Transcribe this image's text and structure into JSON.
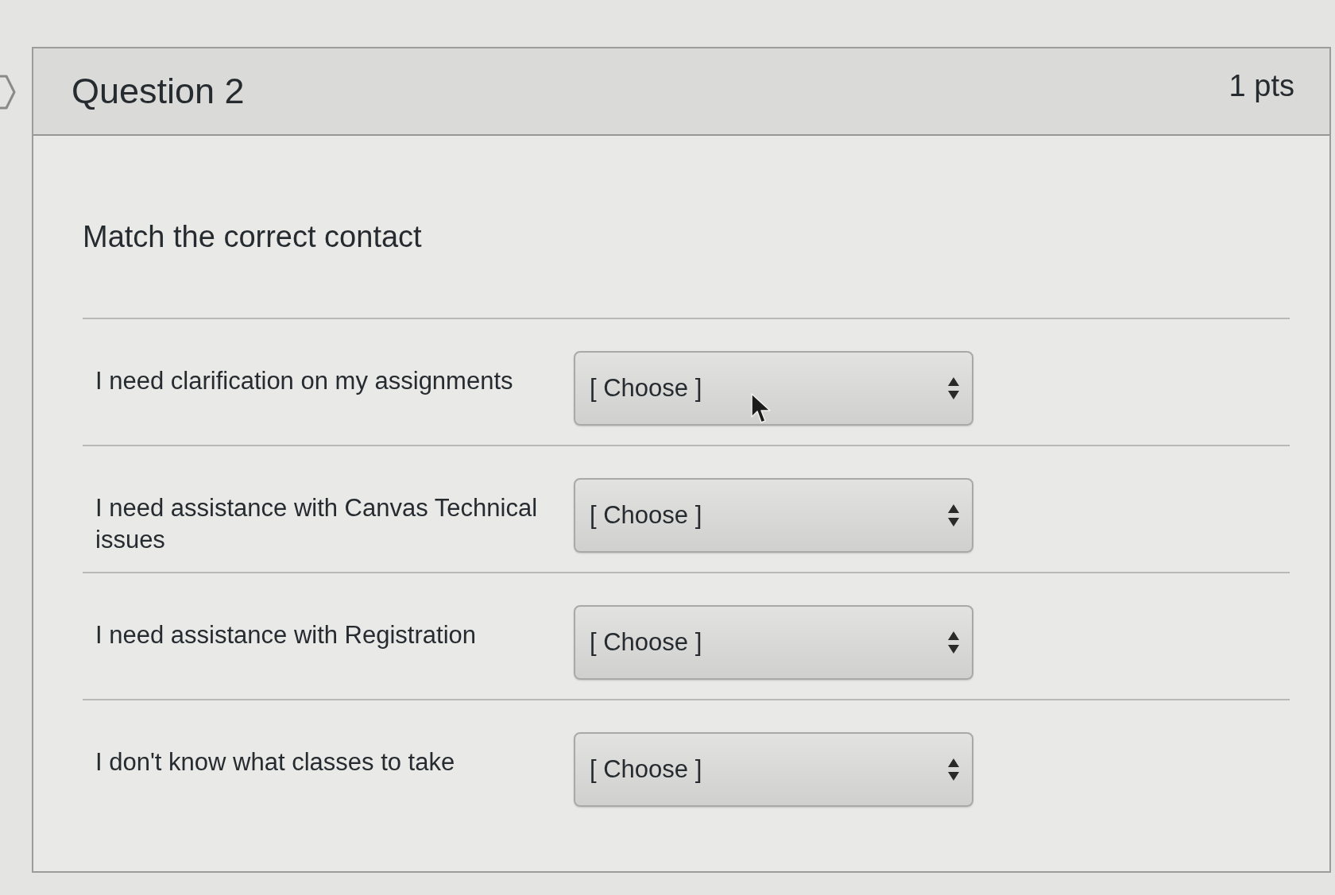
{
  "question": {
    "title": "Question 2",
    "points": "1 pts",
    "prompt": "Match the correct contact",
    "matches": [
      {
        "statement": "I need clarification on my assignments",
        "selection": "[ Choose ]"
      },
      {
        "statement": "I need assistance with Canvas Technical issues",
        "selection": "[ Choose ]"
      },
      {
        "statement": "I need assistance with Registration",
        "selection": "[ Choose ]"
      },
      {
        "statement": "I don't know what classes to take",
        "selection": "[ Choose ]"
      }
    ]
  }
}
